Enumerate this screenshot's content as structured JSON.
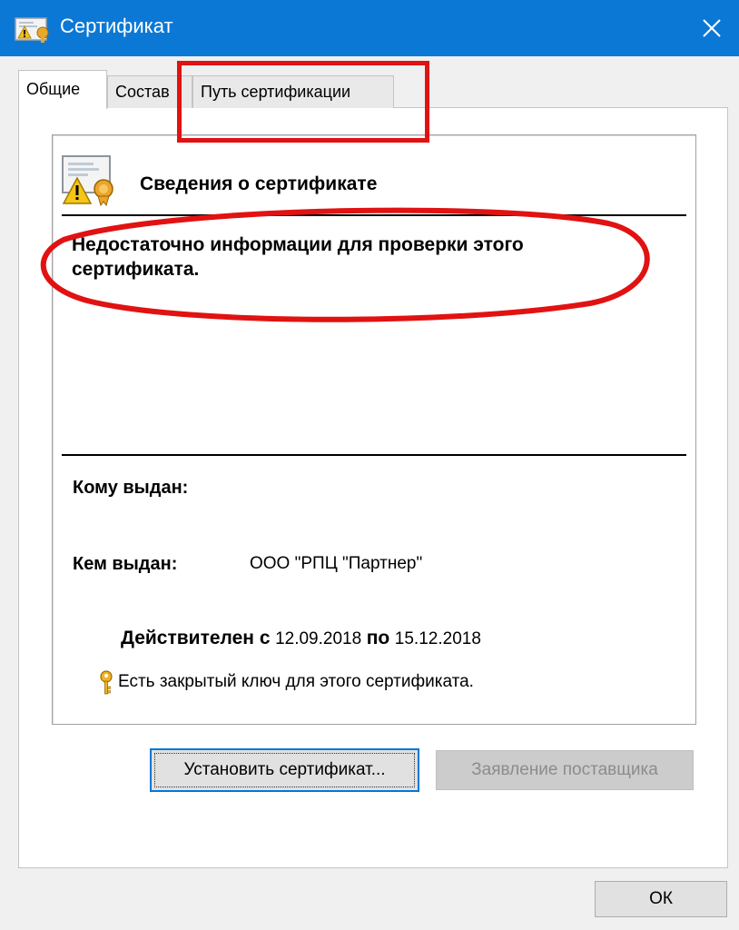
{
  "window": {
    "title": "Сертификат",
    "icon": "certificate-icon",
    "close_icon": "close-icon"
  },
  "tabs": [
    {
      "label": "Общие",
      "active": true
    },
    {
      "label": "Состав",
      "active": false
    },
    {
      "label": "Путь сертификации",
      "active": false
    }
  ],
  "info": {
    "heading": "Сведения о сертификате",
    "warning": "Недостаточно информации для проверки этого сертификата.",
    "issued_to_label": "Кому выдан:",
    "issued_to_value": "",
    "issued_by_label": "Кем выдан:",
    "issued_by_value": "ООО \"РПЦ \"Партнер\"",
    "valid_from_label": "Действителен с",
    "valid_from": "12.09.2018",
    "valid_to_label": "по",
    "valid_to": "15.12.2018",
    "private_key_text": "Есть закрытый ключ для этого сертификата.",
    "icons": [
      "certificate-warning-icon",
      "key-icon"
    ]
  },
  "buttons": {
    "install": "Установить сертификат...",
    "issuer_statement": "Заявление поставщика",
    "ok": "ОК"
  },
  "annotations": {
    "color": "#e11212"
  },
  "colors": {
    "titlebar": "#0c78d6",
    "accent": "#0078d7"
  }
}
